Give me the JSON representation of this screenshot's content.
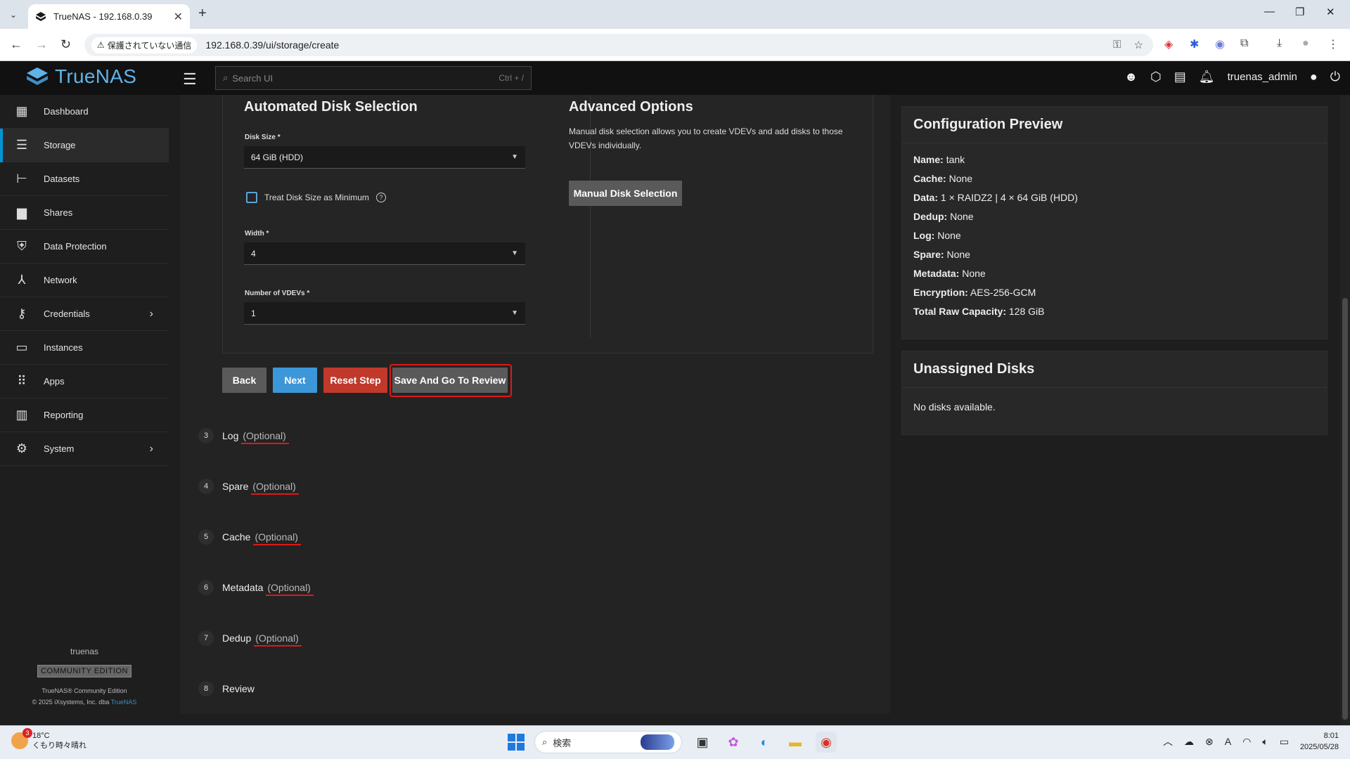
{
  "browser": {
    "tab_title": "TrueNAS - 192.168.0.39",
    "security_chip": "保護されていない通信",
    "url": "192.168.0.39/ui/storage/create"
  },
  "header": {
    "brand": "TrueNAS",
    "search_placeholder": "Search UI",
    "search_shortcut": "Ctrl + /",
    "username": "truenas_admin"
  },
  "sidebar": {
    "items": [
      {
        "label": "Dashboard",
        "icon": "dashboard-icon"
      },
      {
        "label": "Storage",
        "icon": "storage-icon"
      },
      {
        "label": "Datasets",
        "icon": "datasets-icon"
      },
      {
        "label": "Shares",
        "icon": "shares-icon"
      },
      {
        "label": "Data Protection",
        "icon": "shield-icon"
      },
      {
        "label": "Network",
        "icon": "network-icon"
      },
      {
        "label": "Credentials",
        "icon": "key-icon"
      },
      {
        "label": "Instances",
        "icon": "laptop-icon"
      },
      {
        "label": "Apps",
        "icon": "apps-grid-icon"
      },
      {
        "label": "Reporting",
        "icon": "chart-icon"
      },
      {
        "label": "System",
        "icon": "gear-icon"
      }
    ],
    "hostname": "truenas",
    "edition": "COMMUNITY EDITION",
    "copyright1": "TrueNAS® Community Edition",
    "copyright2": "© 2025 iXsystems, Inc. dba",
    "copyright_link": "TrueNAS"
  },
  "wizard": {
    "auto_title": "Automated Disk Selection",
    "disk_size_label": "Disk Size *",
    "disk_size_value": "64 GiB (HDD)",
    "treat_min_label": "Treat Disk Size as Minimum",
    "width_label": "Width *",
    "width_value": "4",
    "vdevs_label": "Number of VDEVs *",
    "vdevs_value": "1",
    "adv_title": "Advanced Options",
    "adv_text": "Manual disk selection allows you to create VDEVs and add disks to those VDEVs individually.",
    "manual_button": "Manual Disk Selection",
    "back_button": "Back",
    "next_button": "Next",
    "reset_button": "Reset Step",
    "save_review_button": "Save And Go To Review",
    "steps": [
      {
        "num": "3",
        "label": "Log",
        "optional": "(Optional)"
      },
      {
        "num": "4",
        "label": "Spare",
        "optional": "(Optional)"
      },
      {
        "num": "5",
        "label": "Cache",
        "optional": "(Optional)"
      },
      {
        "num": "6",
        "label": "Metadata",
        "optional": "(Optional)"
      },
      {
        "num": "7",
        "label": "Dedup",
        "optional": "(Optional)"
      },
      {
        "num": "8",
        "label": "Review",
        "optional": ""
      }
    ]
  },
  "preview": {
    "title": "Configuration Preview",
    "rows": [
      {
        "key": "Name:",
        "value": "tank"
      },
      {
        "key": "Cache:",
        "value": "None"
      },
      {
        "key": "Data:",
        "value": "1 × RAIDZ2 | 4 × 64 GiB (HDD)"
      },
      {
        "key": "Dedup:",
        "value": "None"
      },
      {
        "key": "Log:",
        "value": "None"
      },
      {
        "key": "Spare:",
        "value": "None"
      },
      {
        "key": "Metadata:",
        "value": "None"
      },
      {
        "key": "Encryption:",
        "value": "AES-256-GCM"
      },
      {
        "key": "Total Raw Capacity:",
        "value": "128 GiB"
      }
    ]
  },
  "unassigned": {
    "title": "Unassigned Disks",
    "empty_text": "No disks available."
  },
  "taskbar": {
    "temp": "18°C",
    "weather_text": "くもり時々晴れ",
    "weather_badge": "3",
    "search_label": "検索",
    "time": "8:01",
    "date": "2025/05/28"
  },
  "colors": {
    "accent": "#0095d5",
    "brand": "#5fb3e8",
    "highlight": "#e01818",
    "next_button": "#3c97d8",
    "reset_button": "#c0392b"
  }
}
